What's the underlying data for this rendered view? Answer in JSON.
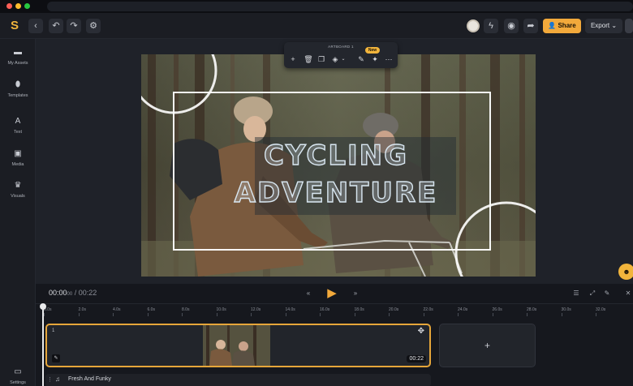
{
  "toolbar": {
    "logo": "S",
    "share_label": "Share",
    "export_label": "Export",
    "icons": [
      "back-icon",
      "undo-icon",
      "redo-icon",
      "settings-icon",
      "avatar",
      "lightning-icon",
      "preview-icon",
      "send-icon"
    ]
  },
  "sidebar": {
    "items": [
      {
        "label": "My Assets",
        "icon": "folder-icon"
      },
      {
        "label": "Templates",
        "icon": "drop-icon"
      },
      {
        "label": "Text",
        "icon": "text-icon"
      },
      {
        "label": "Media",
        "icon": "image-icon"
      },
      {
        "label": "Visuals",
        "icon": "crown-icon"
      },
      {
        "label": "Settings",
        "icon": "settings-icon"
      }
    ]
  },
  "artboard": {
    "toolbar_title": "ARTBOARD 1",
    "new_badge": "New",
    "headline_line1": "CYCLING",
    "headline_line2": "ADVENTURE"
  },
  "playback": {
    "current_time": "00:00",
    "current_frames": "00",
    "separator": "/",
    "total_time": "00:22"
  },
  "timeline": {
    "ticks": [
      "0.0s",
      "2.0s",
      "4.0s",
      "6.0s",
      "8.0s",
      "10.0s",
      "12.0s",
      "14.0s",
      "16.0s",
      "18.0s",
      "20.0s",
      "22.0s",
      "24.0s",
      "26.0s",
      "28.0s",
      "30.0s",
      "32.0s"
    ],
    "clip_index": "1",
    "clip_duration": "00:22",
    "add_scene": "+",
    "audio_label": "Fresh And Funky"
  },
  "colors": {
    "accent": "#f2a93b",
    "clip_border": "#e6a63a"
  }
}
